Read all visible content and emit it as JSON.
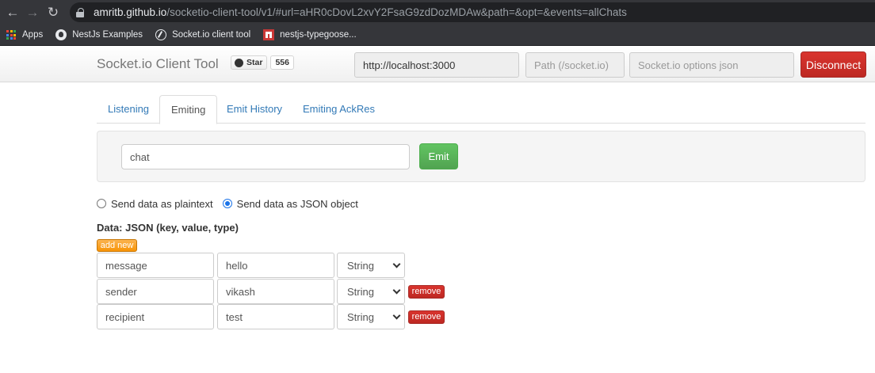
{
  "browser": {
    "url_host": "amritb.github.io",
    "url_path": "/socketio-client-tool/v1/#url=aHR0cDovL2xvY2FsaG9zdDozMDAw&path=&opt=&events=allChats",
    "bookmarks": [
      "Apps",
      "NestJs Examples",
      "Socket.io client tool",
      "nestjs-typegoose..."
    ]
  },
  "header": {
    "brand": "Socket.io Client Tool",
    "star_label": "Star",
    "star_count": "556",
    "url_value": "http://localhost:3000",
    "path_placeholder": "Path (/socket.io)",
    "options_placeholder": "Socket.io options json",
    "disconnect_label": "Disconnect"
  },
  "tabs": [
    "Listening",
    "Emiting",
    "Emit History",
    "Emiting AckRes"
  ],
  "active_tab": "Emiting",
  "emit": {
    "event_value": "chat",
    "emit_label": "Emit"
  },
  "radios": {
    "plaintext_label": "Send data as plaintext",
    "json_label": "Send data as JSON object",
    "selected": "json"
  },
  "data_label": "Data: JSON (key, value, type)",
  "add_new_label": "add new",
  "rows": [
    {
      "key": "message",
      "value": "hello",
      "type": "String",
      "removable": false
    },
    {
      "key": "sender",
      "value": "vikash",
      "type": "String",
      "removable": true
    },
    {
      "key": "recipient",
      "value": "test",
      "type": "String",
      "removable": true
    }
  ],
  "remove_label": "remove",
  "colors": {
    "disconnect": "#d9342e",
    "emit": "#5cb85c",
    "add_new": "#f89406",
    "link": "#337ab7"
  }
}
